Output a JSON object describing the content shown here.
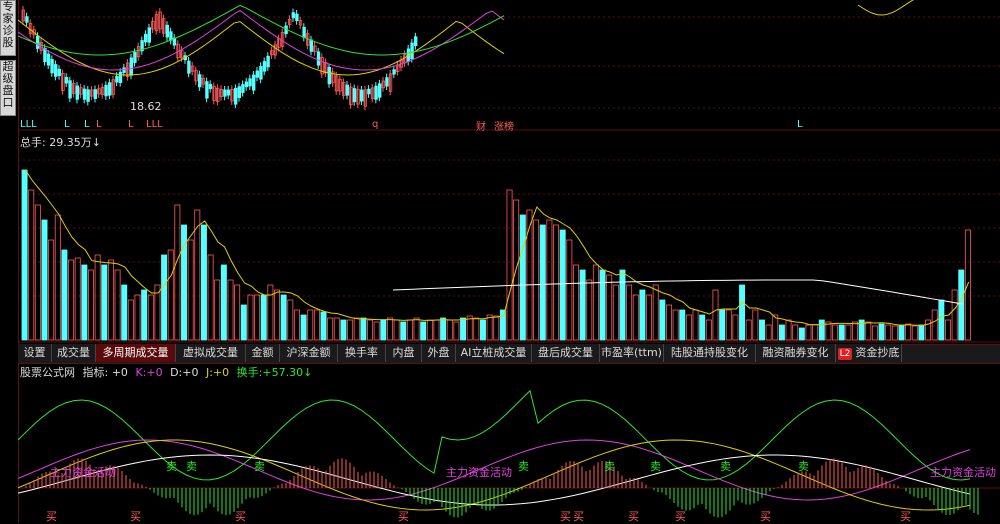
{
  "side_buttons": [
    "专\n家\n诊\n股",
    "超\n级\n盘\n口"
  ],
  "price_panel": {
    "low_label": "18.62",
    "event_markers": {
      "lll": [
        "LLL",
        "L",
        "L",
        "L",
        "L",
        "LLL"
      ],
      "q": "q",
      "cai": "财",
      "zhangbang": "涨榜",
      "l_right": "L"
    }
  },
  "volume_panel": {
    "title": "总手: 29.35万↓"
  },
  "tabs": [
    {
      "label": "设置"
    },
    {
      "label": "成交量"
    },
    {
      "label": "多周期成交量"
    },
    {
      "label": "虚拟成交量"
    },
    {
      "label": "金额"
    },
    {
      "label": "沪深金额"
    },
    {
      "label": "换手率"
    },
    {
      "label": "内盘"
    },
    {
      "label": "外盘"
    },
    {
      "label": "AI立桩成交量"
    },
    {
      "label": "盘后成交量"
    },
    {
      "label": "市盈率(ttm)"
    },
    {
      "label": "陆股通持股变化"
    },
    {
      "label": "融资融券变化"
    },
    {
      "label": "资金抄底",
      "badge": "L2"
    }
  ],
  "active_tab": "多周期成交量",
  "indicator_panel": {
    "title": "股票公式网",
    "prefix": "指标:",
    "v0": "+0",
    "k_label": "K:",
    "k_val": "+0",
    "d_label": "D:",
    "d_val": "+0",
    "j_label": "J:",
    "j_val": "+0",
    "turnover_label": "换手:",
    "turnover_val": "+57.30↓",
    "signals": {
      "zhuli": "主力资金活动",
      "buy": "买",
      "sell": "卖"
    }
  },
  "colors": {
    "bar_up": "#ff5a5a",
    "bar_down": "#54ffff",
    "ma_yellow": "#e0d000",
    "ma_white": "#ffffff",
    "grid_red": "#5a1010",
    "green_line": "#2ee62e",
    "magenta": "#e040e0"
  }
}
